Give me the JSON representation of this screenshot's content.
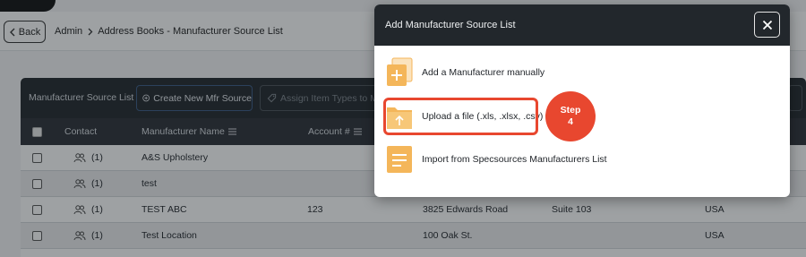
{
  "header": {
    "back_label": "Back",
    "breadcrumb": [
      {
        "label": "Admin"
      },
      {
        "label": "Address Books - Manufacturer Source List"
      }
    ]
  },
  "toolbar": {
    "title": "Manufacturer Source List",
    "create_label": "Create New Mfr Source",
    "assign_placeholder": "Assign Item Types to Mfr"
  },
  "table": {
    "columns": [
      "Contact",
      "Manufacturer Name",
      "Account #"
    ],
    "rows": [
      {
        "contact_count": "(1)",
        "name": "A&S Upholstery",
        "account": "",
        "address": "",
        "suite": "",
        "country": ""
      },
      {
        "contact_count": "(1)",
        "name": "test",
        "account": "",
        "address": "",
        "suite": "",
        "country": ""
      },
      {
        "contact_count": "(1)",
        "name": "TEST ABC",
        "account": "123",
        "address": "3825 Edwards Road",
        "suite": "Suite 103",
        "country": "USA"
      },
      {
        "contact_count": "(1)",
        "name": "Test Location",
        "account": "",
        "address": "100 Oak St.",
        "suite": "",
        "country": "USA"
      }
    ]
  },
  "modal": {
    "title": "Add Manufacturer Source List",
    "options": [
      {
        "label": "Add a Manufacturer manually",
        "icon": "add-file-icon"
      },
      {
        "label": "Upload a file (.xls, .xlsx, .csv)",
        "icon": "upload-folder-icon"
      },
      {
        "label": "Import from Specsources Manufacturers List",
        "icon": "document-list-icon"
      }
    ]
  },
  "annotation": {
    "step_word": "Step",
    "step_number": "4"
  },
  "colors": {
    "dark": "#22272c",
    "accent_orange": "#f4b65a",
    "highlight_red": "#e8472f",
    "button_border_blue": "#3b5a86"
  }
}
